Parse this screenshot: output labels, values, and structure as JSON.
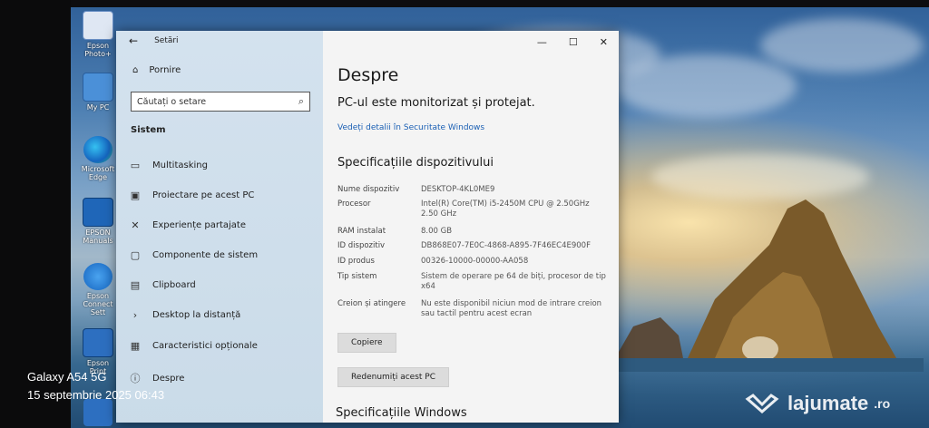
{
  "desktop": {
    "icons": [
      {
        "label": "Epson Photo+"
      },
      {
        "label": "My PC"
      },
      {
        "label": "Microsoft Edge"
      },
      {
        "label": "EPSON Manuals"
      },
      {
        "label": "Epson Connect Sett"
      },
      {
        "label": "Epson Print"
      }
    ]
  },
  "settings_window": {
    "app_title": "Setări",
    "nav": {
      "home": "Pornire",
      "search_placeholder": "Căutați o setare",
      "section": "Sistem",
      "items": [
        {
          "label": "Multitasking",
          "icon": "multitasking-icon"
        },
        {
          "label": "Proiectare pe acest PC",
          "icon": "project-icon"
        },
        {
          "label": "Experiențe partajate",
          "icon": "shared-experiences-icon"
        },
        {
          "label": "Componente de sistem",
          "icon": "system-components-icon"
        },
        {
          "label": "Clipboard",
          "icon": "clipboard-icon"
        },
        {
          "label": "Desktop la distanță",
          "icon": "remote-desktop-icon"
        },
        {
          "label": "Caracteristici opționale",
          "icon": "optional-features-icon"
        },
        {
          "label": "Despre",
          "icon": "info-icon"
        }
      ]
    },
    "content": {
      "title": "Despre",
      "protection": "PC-ul este monitorizat și protejat.",
      "security_link": "Vedeți detalii în Securitate Windows",
      "device_specs_title": "Specificațiile dispozitivului",
      "specs": [
        {
          "key": "Nume dispozitiv",
          "value": "DESKTOP-4KL0ME9"
        },
        {
          "key": "Procesor",
          "value": "Intel(R) Core(TM) i5-2450M CPU @ 2.50GHz 2.50 GHz"
        },
        {
          "key": "RAM instalat",
          "value": "8.00 GB"
        },
        {
          "key": "ID dispozitiv",
          "value": "DB868E07-7E0C-4868-A895-7F46EC4E900F"
        },
        {
          "key": "ID produs",
          "value": "00326-10000-00000-AA058"
        },
        {
          "key": "Tip sistem",
          "value": "Sistem de operare pe 64 de biți, procesor de tip x64"
        },
        {
          "key": "Creion și atingere",
          "value": "Nu este disponibil niciun mod de intrare creion sau tactil pentru acest ecran"
        }
      ],
      "copy_button": "Copiere",
      "rename_button": "Redenumiți acest PC",
      "windows_specs_title": "Specificațiile Windows"
    },
    "controls": {
      "minimize": "—",
      "maximize": "☐",
      "close": "✕"
    }
  },
  "overlay": {
    "phone_model": "Galaxy A54 5G",
    "timestamp": "15 septembrie 2025 06:43",
    "brand": "lajumate",
    "brand_tld": ".ro"
  }
}
